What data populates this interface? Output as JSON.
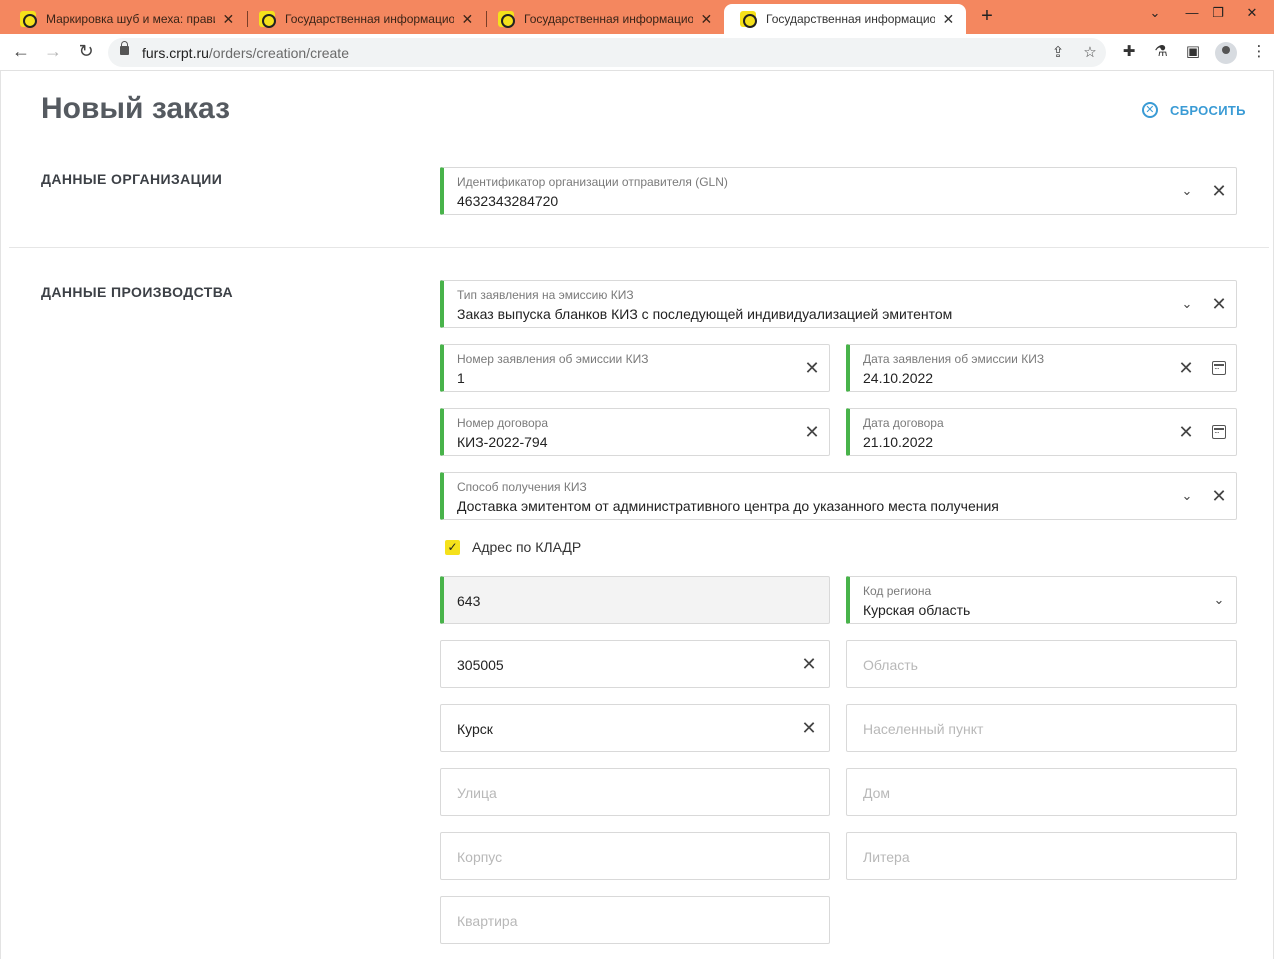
{
  "browser": {
    "tabs": [
      {
        "title": "Маркировка шуб и меха: прави",
        "active": false
      },
      {
        "title": "Государственная информацион",
        "active": false
      },
      {
        "title": "Государственная информацион",
        "active": false
      },
      {
        "title": "Государственная информацион",
        "active": true
      }
    ],
    "close_glyph": "✕",
    "new_tab_glyph": "+",
    "url_host": "furs.crpt.ru",
    "url_path": "/orders/creation/create"
  },
  "page": {
    "title": "Новый заказ",
    "reset_label": "СБРОСИТЬ",
    "sections": {
      "org": "ДАННЫЕ ОРГАНИЗАЦИИ",
      "production": "ДАННЫЕ ПРОИЗВОДСТВА"
    },
    "fields": {
      "gln": {
        "label": "Идентификатор организации отправителя (GLN)",
        "value": "4632343284720"
      },
      "app_type": {
        "label": "Тип заявления на эмиссию КИЗ",
        "value": "Заказ выпуска бланков КИЗ с последующей индивидуализацией эмитентом"
      },
      "app_number": {
        "label": "Номер заявления об эмиссии КИЗ",
        "value": "1"
      },
      "app_date": {
        "label": "Дата заявления об эмиссии КИЗ",
        "value": "24.10.2022"
      },
      "contract_number": {
        "label": "Номер договора",
        "value": "КИЗ-2022-794"
      },
      "contract_date": {
        "label": "Дата договора",
        "value": "21.10.2022"
      },
      "receive_method": {
        "label": "Способ получения КИЗ",
        "value": "Доставка эмитентом от административного центра до указанного места получения"
      },
      "country": {
        "value": "643"
      },
      "region": {
        "label": "Код региона",
        "value": "Курская область"
      },
      "postcode": {
        "value": "305005"
      },
      "oblast": {
        "placeholder": "Область"
      },
      "city": {
        "value": "Курск"
      },
      "locality": {
        "placeholder": "Населенный пункт"
      },
      "street": {
        "placeholder": "Улица"
      },
      "house": {
        "placeholder": "Дом"
      },
      "building": {
        "placeholder": "Корпус"
      },
      "letter": {
        "placeholder": "Литера"
      },
      "apartment": {
        "placeholder": "Квартира"
      }
    },
    "kladr_checkbox": {
      "label": "Адрес по КЛАДР",
      "checked": true
    }
  },
  "colors": {
    "tabstrip": "#f4875f",
    "accent_green": "#48b34a",
    "reset_blue": "#3a9bd5",
    "checkbox_yellow": "#f5e11b"
  }
}
